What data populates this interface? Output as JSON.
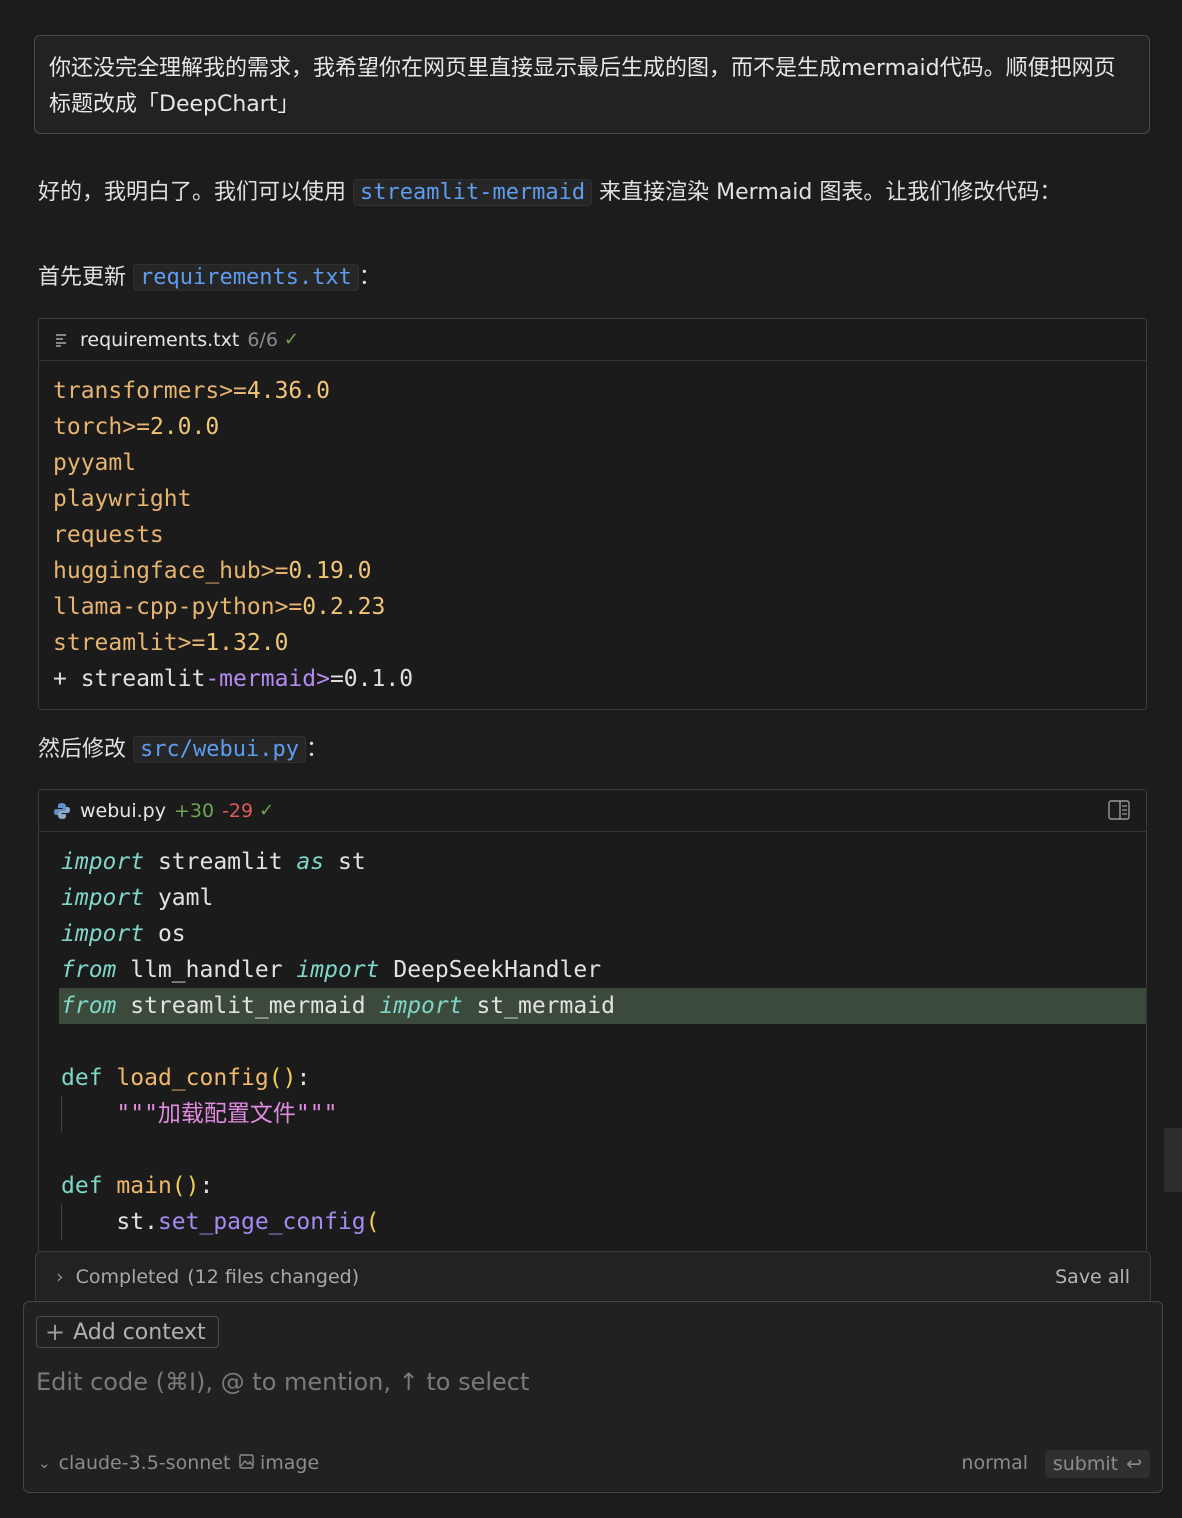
{
  "user_message": "你还没完全理解我的需求，我希望你在网页里直接显示最后生成的图，而不是生成mermaid代码。顺便把网页标题改成「DeepChart」",
  "reply": {
    "p1_before": "好的，我明白了。我们可以使用 ",
    "p1_code": "streamlit-mermaid",
    "p1_after": " 来直接渲染 Mermaid 图表。让我们修改代码：",
    "p2_before": "首先更新 ",
    "p2_code": "requirements.txt",
    "p2_after": "：",
    "p3_before": "然后修改 ",
    "p3_code": "src/webui.py",
    "p3_after": "："
  },
  "req_block": {
    "filename": "requirements.txt",
    "progress": "6/6",
    "check": "✓",
    "lines": [
      {
        "pkg": "transformers",
        "op": ">=",
        "ver": "4.36.0"
      },
      {
        "pkg": "torch",
        "op": ">=",
        "ver": "2.0.0"
      },
      {
        "pkg": "pyyaml",
        "op": "",
        "ver": ""
      },
      {
        "pkg": "playwright",
        "op": "",
        "ver": ""
      },
      {
        "pkg": "requests",
        "op": "",
        "ver": ""
      },
      {
        "pkg": "huggingface_hub",
        "op": ">=",
        "ver": "0.19.0"
      },
      {
        "pkg": "llama-cpp-python",
        "op": ">=",
        "ver": "0.2.23"
      },
      {
        "pkg": "streamlit",
        "op": ">=",
        "ver": "1.32.0"
      }
    ],
    "added_line": {
      "prefix": "+ streamlit",
      "mid": "-mermaid>",
      "suffix": "=0.1.0"
    }
  },
  "py_block": {
    "filename": "webui.py",
    "added": "+30",
    "removed": "-29",
    "check": "✓",
    "lines": [
      {
        "a": "import",
        "b": " streamlit ",
        "c": "as",
        "d": " st"
      },
      {
        "a": "import",
        "b": " yaml"
      },
      {
        "a": "import",
        "b": " os"
      },
      {
        "a": "from",
        "b": " llm_handler ",
        "c": "import",
        "d": " DeepSeekHandler"
      },
      {
        "a": "from",
        "b": " streamlit_mermaid ",
        "c": "import",
        "d": " st_mermaid"
      },
      {
        "def": "def",
        "fn": "load_config",
        "open": "()",
        "colon": ":"
      },
      {
        "str": "\"\"\"加载配置文件\"\"\""
      },
      {
        "def": "def",
        "fn": "main",
        "open": "()",
        "colon": ":"
      },
      {
        "obj": "st.",
        "meth": "set_page_config",
        "paren": "("
      }
    ]
  },
  "status": {
    "label": "Completed",
    "detail": "(12 files changed)",
    "save_all": "Save all"
  },
  "composer": {
    "add_context": "Add context",
    "placeholder": "Edit code (⌘I), @ to mention, ↑ to select",
    "model": "claude-3.5-sonnet",
    "image": "image",
    "mode": "normal",
    "submit": "submit"
  },
  "colors": {
    "accent_code": "#5e9cf0",
    "added": "#6aa84f",
    "removed": "#e05a5a",
    "highlight": "#3b4a3b"
  }
}
